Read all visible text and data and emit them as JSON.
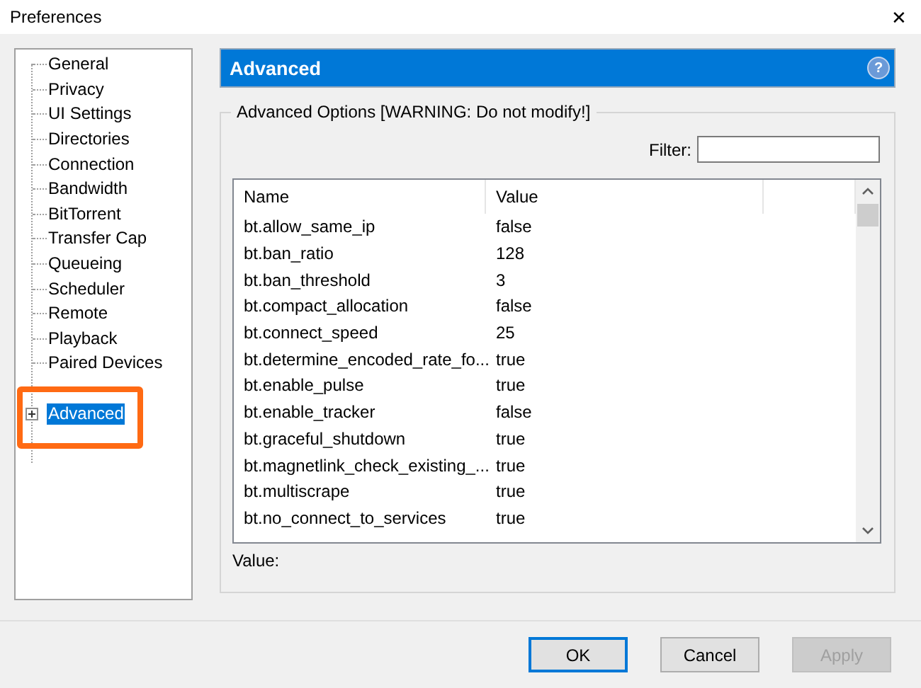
{
  "window": {
    "title": "Preferences",
    "close": "✕"
  },
  "sidebar": {
    "items": [
      {
        "label": "General",
        "selected": false
      },
      {
        "label": "Privacy",
        "selected": false
      },
      {
        "label": "UI Settings",
        "selected": false
      },
      {
        "label": "Directories",
        "selected": false
      },
      {
        "label": "Connection",
        "selected": false
      },
      {
        "label": "Bandwidth",
        "selected": false
      },
      {
        "label": "BitTorrent",
        "selected": false
      },
      {
        "label": "Transfer Cap",
        "selected": false
      },
      {
        "label": "Queueing",
        "selected": false
      },
      {
        "label": "Scheduler",
        "selected": false
      },
      {
        "label": "Remote",
        "selected": false
      },
      {
        "label": "Playback",
        "selected": false
      },
      {
        "label": "Paired Devices",
        "selected": false
      },
      {
        "label": "Advanced",
        "selected": true,
        "expanded": false
      }
    ]
  },
  "header": {
    "title": "Advanced",
    "help": "?"
  },
  "group": {
    "legend": "Advanced Options [WARNING: Do not modify!]",
    "filter": {
      "label": "Filter:"
    },
    "table": {
      "columns": [
        "Name",
        "Value"
      ],
      "rows": [
        {
          "name": "bt.allow_same_ip",
          "value": "false"
        },
        {
          "name": "bt.ban_ratio",
          "value": "128"
        },
        {
          "name": "bt.ban_threshold",
          "value": "3"
        },
        {
          "name": "bt.compact_allocation",
          "value": "false"
        },
        {
          "name": "bt.connect_speed",
          "value": "25"
        },
        {
          "name": "bt.determine_encoded_rate_fo...",
          "value": "true"
        },
        {
          "name": "bt.enable_pulse",
          "value": "true"
        },
        {
          "name": "bt.enable_tracker",
          "value": "false"
        },
        {
          "name": "bt.graceful_shutdown",
          "value": "true"
        },
        {
          "name": "bt.magnetlink_check_existing_...",
          "value": "true"
        },
        {
          "name": "bt.multiscrape",
          "value": "true"
        },
        {
          "name": "bt.no_connect_to_services",
          "value": "true"
        }
      ]
    },
    "value_label": "Value:"
  },
  "buttons": [
    {
      "label": "OK",
      "default": true,
      "disabled": false
    },
    {
      "label": "Cancel",
      "default": false,
      "disabled": false
    },
    {
      "label": "Apply",
      "default": false,
      "disabled": true
    }
  ]
}
